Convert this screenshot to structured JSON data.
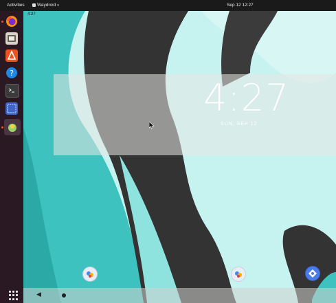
{
  "topbar": {
    "activities": "Activities",
    "app_menu": "Waydroid",
    "clock": "Sep 12  12:27"
  },
  "dock": {
    "items": [
      {
        "name": "firefox-icon",
        "running": true
      },
      {
        "name": "files-icon",
        "running": false
      },
      {
        "name": "software-icon",
        "running": false
      },
      {
        "name": "help-icon",
        "running": false
      },
      {
        "name": "terminal-icon",
        "running": false
      },
      {
        "name": "screenshot-icon",
        "running": false
      },
      {
        "name": "waydroid-icon",
        "running": true
      }
    ],
    "apps_grid_icon": "show-apps-icon"
  },
  "android": {
    "status_time": "4:27",
    "lock_clock": "4:27",
    "lock_date": "SUN, SEP 12",
    "navbar": {
      "back_icon": "back-triangle-icon",
      "home_icon": "home-circle-icon"
    },
    "home_apps": [
      {
        "name": "app-icon-1"
      },
      {
        "name": "app-icon-2"
      },
      {
        "name": "app-icon-3"
      }
    ]
  },
  "colors": {
    "wallpaper_light": "#c6f2ef",
    "wallpaper_teal": "#3ec2bf",
    "wallpaper_dark": "#333333",
    "wallpaper_mid": "#8fe3df",
    "dock_bg": "#2a1823",
    "accent": "#e95420"
  }
}
